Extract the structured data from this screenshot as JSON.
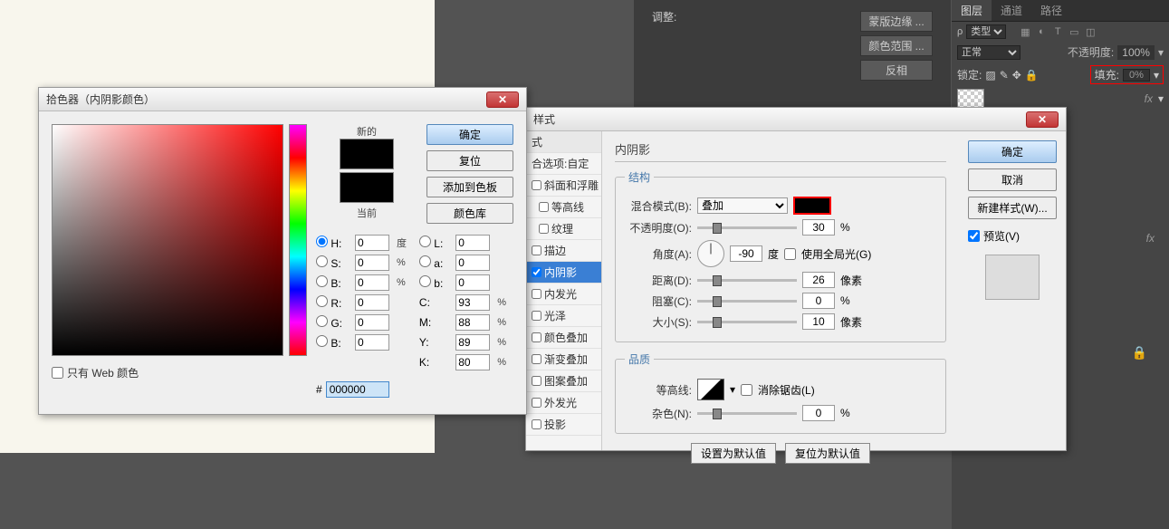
{
  "canvas": {},
  "side_panel": {
    "adjust_label": "调整:",
    "mask_edge_btn": "蒙版边缘 ...",
    "color_range_btn": "颜色范围 ...",
    "invert_btn": "反相"
  },
  "layers_panel": {
    "tabs": [
      "图层",
      "通道",
      "路径"
    ],
    "type_label": "类型",
    "blend_mode": "正常",
    "opacity_label": "不透明度:",
    "opacity_value": "100%",
    "lock_label": "锁定:",
    "fill_label": "填充:",
    "fill_value": "0%",
    "fx_label": "fx"
  },
  "color_picker": {
    "title": "拾色器（内阴影颜色）",
    "new_label": "新的",
    "current_label": "当前",
    "ok_btn": "确定",
    "reset_btn": "复位",
    "add_swatch_btn": "添加到色板",
    "color_lib_btn": "颜色库",
    "web_only_label": "只有 Web 颜色",
    "h_label": "H:",
    "h_val": "0",
    "h_unit": "度",
    "s_label": "S:",
    "s_val": "0",
    "s_unit": "%",
    "b_label": "B:",
    "b_val": "0",
    "b_unit": "%",
    "r_label": "R:",
    "r_val": "0",
    "g_label": "G:",
    "g_val": "0",
    "b2_label": "B:",
    "b2_val": "0",
    "l_label": "L:",
    "l_val": "0",
    "a_label": "a:",
    "a_val": "0",
    "lb_label": "b:",
    "lb_val": "0",
    "c_label": "C:",
    "c_val": "93",
    "c_unit": "%",
    "m_label": "M:",
    "m_val": "88",
    "m_unit": "%",
    "y_label": "Y:",
    "y_val": "89",
    "y_unit": "%",
    "k_label": "K:",
    "k_val": "80",
    "k_unit": "%",
    "hex_prefix": "#",
    "hex_val": "000000"
  },
  "layer_style": {
    "title": "样式",
    "styles_list": {
      "header": "式",
      "blend_options": "合选项:自定",
      "bevel": "斜面和浮雕",
      "contour_sub": "等高线",
      "texture_sub": "纹理",
      "stroke": "描边",
      "inner_shadow": "内阴影",
      "inner_glow": "内发光",
      "satin": "光泽",
      "color_overlay": "颜色叠加",
      "gradient_overlay": "渐变叠加",
      "pattern_overlay": "图案叠加",
      "outer_glow": "外发光",
      "drop_shadow": "投影"
    },
    "section_title": "内阴影",
    "structure_legend": "结构",
    "blend_mode_label": "混合模式(B):",
    "blend_mode_value": "叠加",
    "opacity_label": "不透明度(O):",
    "opacity_value": "30",
    "opacity_unit": "%",
    "angle_label": "角度(A):",
    "angle_value": "-90",
    "angle_unit": "度",
    "global_light_label": "使用全局光(G)",
    "distance_label": "距离(D):",
    "distance_value": "26",
    "distance_unit": "像素",
    "choke_label": "阻塞(C):",
    "choke_value": "0",
    "choke_unit": "%",
    "size_label": "大小(S):",
    "size_value": "10",
    "size_unit": "像素",
    "quality_legend": "品质",
    "contour_label": "等高线:",
    "antialias_label": "消除锯齿(L)",
    "noise_label": "杂色(N):",
    "noise_value": "0",
    "noise_unit": "%",
    "make_default_btn": "设置为默认值",
    "reset_default_btn": "复位为默认值",
    "ok_btn": "确定",
    "cancel_btn": "取消",
    "new_style_btn": "新建样式(W)...",
    "preview_label": "预览(V)"
  }
}
